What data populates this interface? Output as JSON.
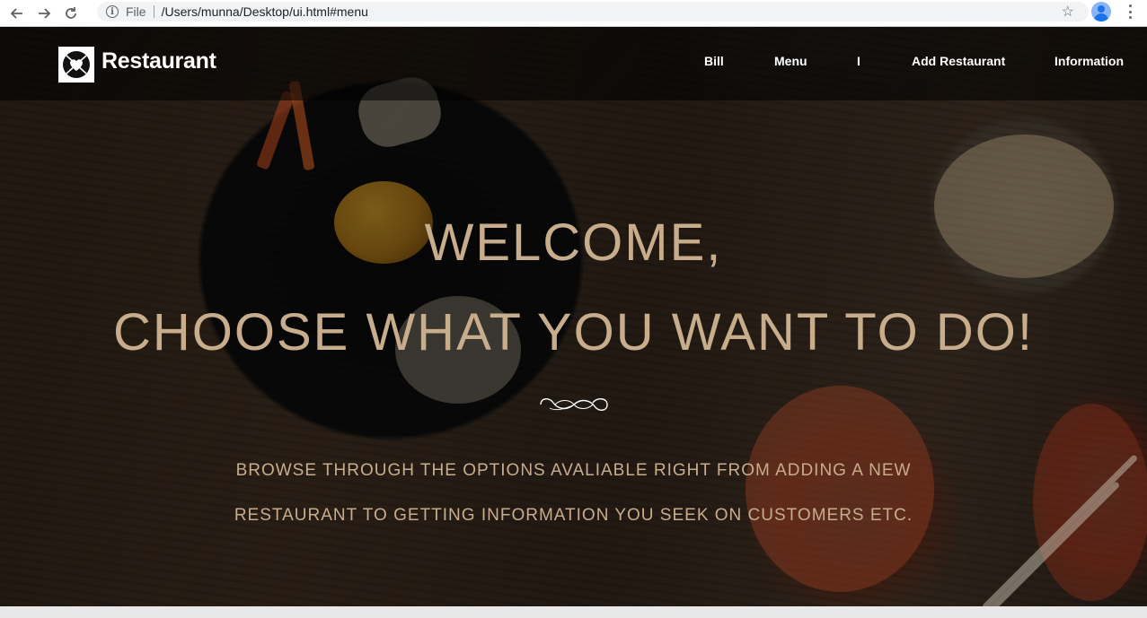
{
  "browser": {
    "scheme": "File",
    "url": "/Users/munna/Desktop/ui.html#menu",
    "icons": [
      "back-icon",
      "forward-icon",
      "reload-icon",
      "info-icon",
      "star-icon",
      "profile-icon",
      "kebab-menu-icon"
    ]
  },
  "header": {
    "brand": "Restaurant",
    "nav": [
      "Bill",
      "Menu",
      "I",
      "Add Restaurant",
      "Information"
    ]
  },
  "hero": {
    "welcome": "WELCOME,",
    "headline": "CHOOSE WHAT YOU WANT TO DO!",
    "description_line1": "BROWSE THROUGH THE OPTIONS AVALIABLE RIGHT FROM ADDING A NEW",
    "description_line2": "RESTAURANT TO GETTING INFORMATION YOU SEEK ON CUSTOMERS ETC."
  },
  "colors": {
    "accent_text": "#c7ad8c",
    "header_text": "#ffffff",
    "header_bg": "#000000"
  }
}
